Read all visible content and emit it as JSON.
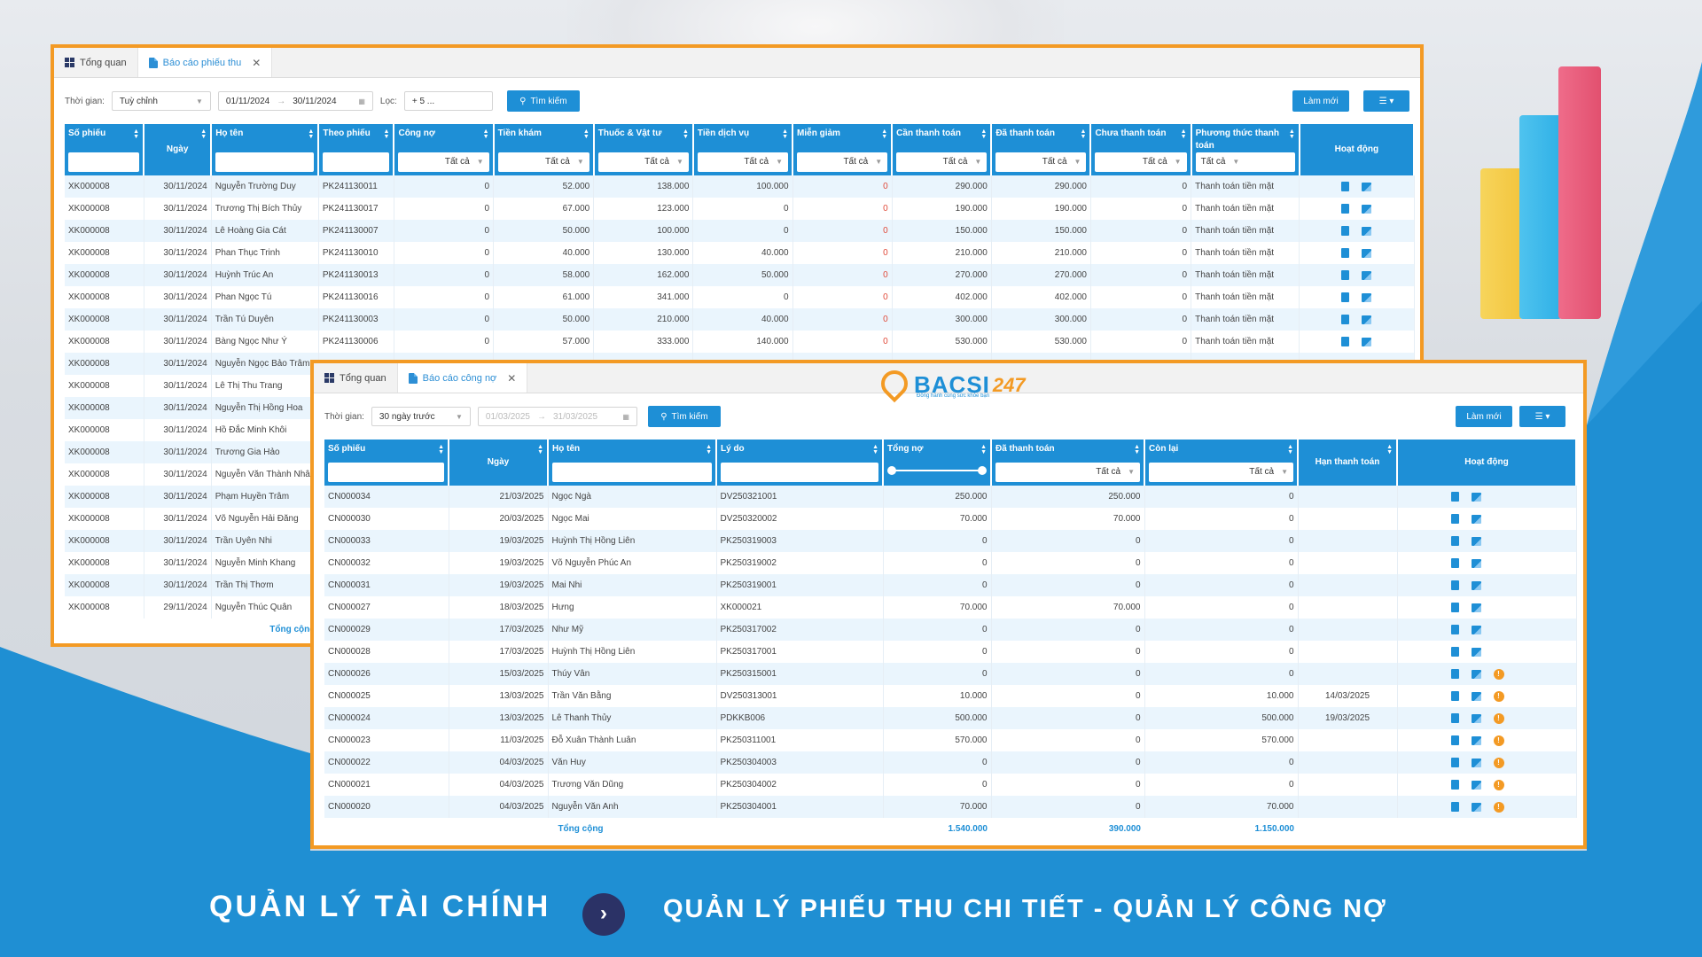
{
  "colors": {
    "accent": "#1e8fd6",
    "border": "#f39a24",
    "navy": "#2b3266",
    "banner": "#1f8fd3"
  },
  "win1": {
    "tabs": [
      {
        "label": "Tổng quan",
        "icon": "grid-icon"
      },
      {
        "label": "Báo cáo phiếu thu",
        "icon": "document-icon",
        "active": true
      }
    ],
    "filter": {
      "time_label": "Thời gian:",
      "time_value": "Tuỳ chỉnh",
      "date_from": "01/11/2024",
      "date_to": "30/11/2024",
      "filter_label": "Lọc:",
      "filter_value": "+ 5 ...",
      "search_label": "Tìm kiếm",
      "refresh_label": "Làm mới"
    },
    "columns": [
      "Số phiếu",
      "Ngày",
      "Họ tên",
      "Theo phiếu",
      "Công nợ",
      "Tiền khám",
      "Thuốc & Vật tư",
      "Tiền dịch vụ",
      "Miễn giảm",
      "Cần thanh toán",
      "Đã thanh toán",
      "Chưa thanh toán",
      "Phương thức thanh toán",
      "Hoạt động"
    ],
    "filter_all": "Tất cả",
    "rows": [
      [
        "XK000008",
        "30/11/2024",
        "Nguyễn Trường Duy",
        "PK241130011",
        "0",
        "52.000",
        "138.000",
        "100.000",
        "0",
        "290.000",
        "290.000",
        "0",
        "Thanh toán tiền mặt"
      ],
      [
        "XK000008",
        "30/11/2024",
        "Trương Thị Bích Thủy",
        "PK241130017",
        "0",
        "67.000",
        "123.000",
        "0",
        "0",
        "190.000",
        "190.000",
        "0",
        "Thanh toán tiền mặt"
      ],
      [
        "XK000008",
        "30/11/2024",
        "Lê Hoàng Gia Cát",
        "PK241130007",
        "0",
        "50.000",
        "100.000",
        "0",
        "0",
        "150.000",
        "150.000",
        "0",
        "Thanh toán tiền mặt"
      ],
      [
        "XK000008",
        "30/11/2024",
        "Phan Thục Trinh",
        "PK241130010",
        "0",
        "40.000",
        "130.000",
        "40.000",
        "0",
        "210.000",
        "210.000",
        "0",
        "Thanh toán tiền mặt"
      ],
      [
        "XK000008",
        "30/11/2024",
        "Huỳnh Trúc An",
        "PK241130013",
        "0",
        "58.000",
        "162.000",
        "50.000",
        "0",
        "270.000",
        "270.000",
        "0",
        "Thanh toán tiền mặt"
      ],
      [
        "XK000008",
        "30/11/2024",
        "Phan Ngọc Tú",
        "PK241130016",
        "0",
        "61.000",
        "341.000",
        "0",
        "0",
        "402.000",
        "402.000",
        "0",
        "Thanh toán tiền mặt"
      ],
      [
        "XK000008",
        "30/11/2024",
        "Trần Tú Duyên",
        "PK241130003",
        "0",
        "50.000",
        "210.000",
        "40.000",
        "0",
        "300.000",
        "300.000",
        "0",
        "Thanh toán tiền mặt"
      ],
      [
        "XK000008",
        "30/11/2024",
        "Bàng Ngọc Như Ý",
        "PK241130006",
        "0",
        "57.000",
        "333.000",
        "140.000",
        "0",
        "530.000",
        "530.000",
        "0",
        "Thanh toán tiền mặt"
      ],
      [
        "XK000008",
        "30/11/2024",
        "Nguyễn Ngọc Bảo Trâm",
        "",
        "",
        "",
        "",
        "",
        "",
        "",
        "",
        "",
        ""
      ],
      [
        "XK000008",
        "30/11/2024",
        "Lê Thị Thu Trang",
        "",
        "",
        "",
        "",
        "",
        "",
        "",
        "",
        "",
        ""
      ],
      [
        "XK000008",
        "30/11/2024",
        "Nguyễn Thị Hồng Hoa",
        "",
        "",
        "",
        "",
        "",
        "",
        "",
        "",
        "",
        ""
      ],
      [
        "XK000008",
        "30/11/2024",
        "Hồ Đắc Minh Khôi",
        "",
        "",
        "",
        "",
        "",
        "",
        "",
        "",
        "",
        ""
      ],
      [
        "XK000008",
        "30/11/2024",
        "Trương Gia Hảo",
        "",
        "",
        "",
        "",
        "",
        "",
        "",
        "",
        "",
        ""
      ],
      [
        "XK000008",
        "30/11/2024",
        "Nguyễn Văn Thành Nhân",
        "",
        "",
        "",
        "",
        "",
        "",
        "",
        "",
        "",
        ""
      ],
      [
        "XK000008",
        "30/11/2024",
        "Phạm Huyền Trâm",
        "",
        "",
        "",
        "",
        "",
        "",
        "",
        "",
        "",
        ""
      ],
      [
        "XK000008",
        "30/11/2024",
        "Võ Nguyễn Hải Đăng",
        "",
        "",
        "",
        "",
        "",
        "",
        "",
        "",
        "",
        ""
      ],
      [
        "XK000008",
        "30/11/2024",
        "Trần Uyên Nhi",
        "",
        "",
        "",
        "",
        "",
        "",
        "",
        "",
        "",
        ""
      ],
      [
        "XK000008",
        "30/11/2024",
        "Nguyễn Minh Khang",
        "",
        "",
        "",
        "",
        "",
        "",
        "",
        "",
        "",
        ""
      ],
      [
        "XK000008",
        "30/11/2024",
        "Trần Thị Thơm",
        "",
        "",
        "",
        "",
        "",
        "",
        "",
        "",
        "",
        ""
      ],
      [
        "XK000008",
        "29/11/2024",
        "Nguyễn Thúc Quân",
        "",
        "",
        "",
        "",
        "",
        "",
        "",
        "",
        "",
        ""
      ]
    ],
    "total_label": "Tổng cộng"
  },
  "win2": {
    "tabs": [
      {
        "label": "Tổng quan",
        "icon": "grid-icon"
      },
      {
        "label": "Báo cáo công nợ",
        "icon": "document-icon",
        "active": true
      }
    ],
    "logo": {
      "text": "BACSI",
      "num": "247",
      "slogan": "Đồng hành cùng sức khỏe bạn"
    },
    "filter": {
      "time_label": "Thời gian:",
      "time_value": "30 ngày trước",
      "date_from": "01/03/2025",
      "date_to": "31/03/2025",
      "search_label": "Tìm kiếm",
      "refresh_label": "Làm mới"
    },
    "columns": [
      "Số phiếu",
      "Ngày",
      "Họ tên",
      "Lý do",
      "Tổng nợ",
      "Đã thanh toán",
      "Còn lại",
      "Hạn thanh toán",
      "Hoạt động"
    ],
    "filter_all": "Tất cả",
    "rows": [
      [
        "CN000034",
        "21/03/2025",
        "Ngọc Ngà",
        "DV250321001",
        "250.000",
        "250.000",
        "0",
        "",
        false
      ],
      [
        "CN000030",
        "20/03/2025",
        "Ngọc Mai",
        "DV250320002",
        "70.000",
        "70.000",
        "0",
        "",
        false
      ],
      [
        "CN000033",
        "19/03/2025",
        "Huỳnh Thị Hồng Liên",
        "PK250319003",
        "0",
        "0",
        "0",
        "",
        false
      ],
      [
        "CN000032",
        "19/03/2025",
        "Võ Nguyễn Phúc An",
        "PK250319002",
        "0",
        "0",
        "0",
        "",
        false
      ],
      [
        "CN000031",
        "19/03/2025",
        "Mai Nhi",
        "PK250319001",
        "0",
        "0",
        "0",
        "",
        false
      ],
      [
        "CN000027",
        "18/03/2025",
        "Hưng",
        "XK000021",
        "70.000",
        "70.000",
        "0",
        "",
        false
      ],
      [
        "CN000029",
        "17/03/2025",
        "Như Mỹ",
        "PK250317002",
        "0",
        "0",
        "0",
        "",
        false
      ],
      [
        "CN000028",
        "17/03/2025",
        "Huỳnh Thị Hồng Liên",
        "PK250317001",
        "0",
        "0",
        "0",
        "",
        false
      ],
      [
        "CN000026",
        "15/03/2025",
        "Thúy Vân",
        "PK250315001",
        "0",
        "0",
        "0",
        "",
        true
      ],
      [
        "CN000025",
        "13/03/2025",
        "Trần Văn Bằng",
        "DV250313001",
        "10.000",
        "0",
        "10.000",
        "14/03/2025",
        true
      ],
      [
        "CN000024",
        "13/03/2025",
        "Lê Thanh Thủy",
        "PDKKB006",
        "500.000",
        "0",
        "500.000",
        "19/03/2025",
        true
      ],
      [
        "CN000023",
        "11/03/2025",
        "Đỗ Xuân Thành Luân",
        "PK250311001",
        "570.000",
        "0",
        "570.000",
        "",
        true
      ],
      [
        "CN000022",
        "04/03/2025",
        "Văn Huy",
        "PK250304003",
        "0",
        "0",
        "0",
        "",
        true
      ],
      [
        "CN000021",
        "04/03/2025",
        "Trương Văn Dũng",
        "PK250304002",
        "0",
        "0",
        "0",
        "",
        true
      ],
      [
        "CN000020",
        "04/03/2025",
        "Nguyễn Văn Anh",
        "PK250304001",
        "70.000",
        "0",
        "70.000",
        "",
        true
      ]
    ],
    "total": {
      "label": "Tổng cộng",
      "tong_no": "1.540.000",
      "da_thanh_toan": "390.000",
      "con_lai": "1.150.000"
    }
  },
  "banner": {
    "left": "QUẢN LÝ TÀI CHÍNH",
    "right": "QUẢN LÝ PHIẾU THU CHI TIẾT - QUẢN LÝ CÔNG NỢ"
  }
}
